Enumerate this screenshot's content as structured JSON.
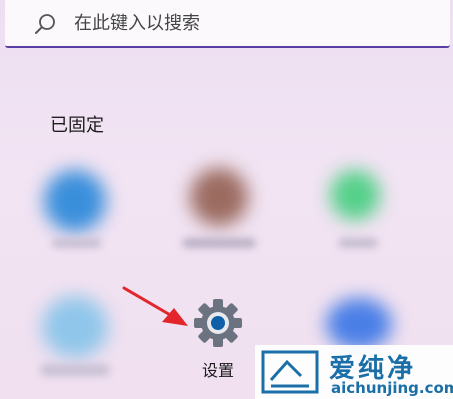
{
  "search": {
    "placeholder": "在此键入以搜索",
    "icon": "search-icon"
  },
  "pinned": {
    "title": "已固定",
    "apps": [
      {
        "label": "设置",
        "icon": "gear-icon",
        "accent": "#0f5ea8"
      }
    ]
  },
  "watermark": {
    "brand": "爱纯净",
    "site": "aichunjing.com"
  },
  "colors": {
    "accent": "#5a3ea3",
    "arrow": "#e3262c",
    "watermark": "#1a6fa8"
  }
}
